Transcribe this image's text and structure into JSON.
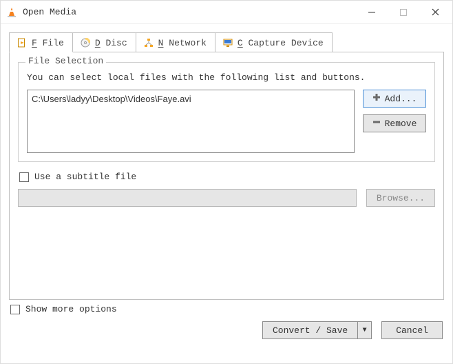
{
  "window": {
    "title": "Open Media"
  },
  "tabs": {
    "file": " File",
    "disc": " Disc",
    "network": " Network",
    "capture": " Capture Device"
  },
  "fileSection": {
    "legend": " File Selection",
    "desc": "You can select local files with the following list and buttons.",
    "items": [
      "C:\\Users\\ladyy\\Desktop\\Videos\\Faye.avi"
    ],
    "addLabel": "Add...",
    "removeLabel": "Remove"
  },
  "subtitle": {
    "checkboxLabel": "Use a subtitle file",
    "browseLabel": "Browse..."
  },
  "bottom": {
    "showMore": "Show more options",
    "convertLabel": "Convert / Save",
    "cancelLabel": "Cancel"
  }
}
